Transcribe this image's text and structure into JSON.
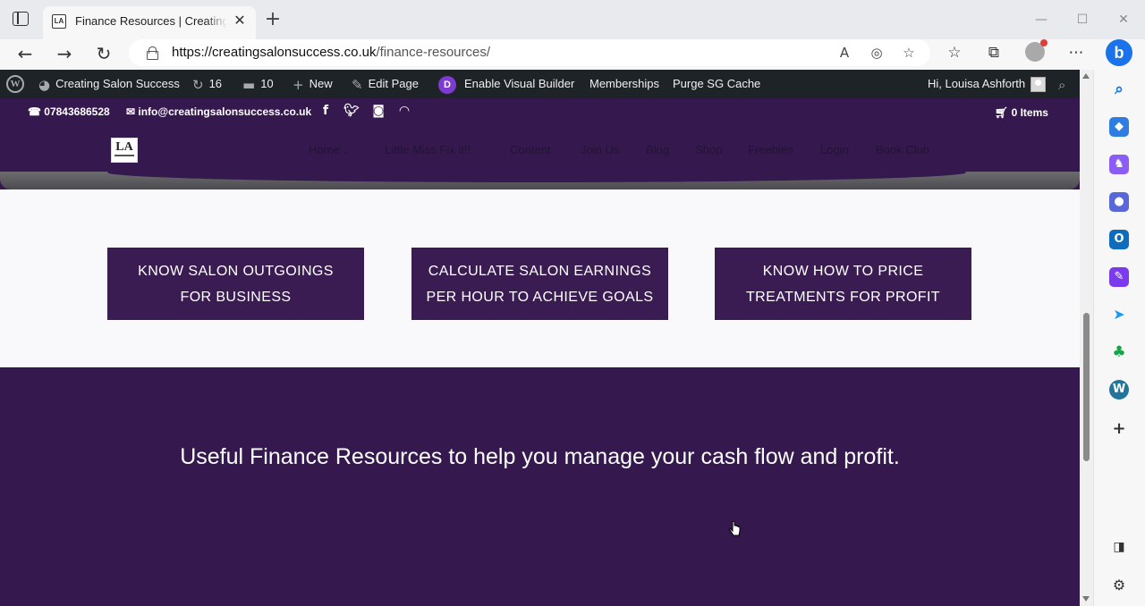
{
  "browser": {
    "tab_title": "Finance Resources | Creating Salon Success",
    "tab_favicon": "LA",
    "url_host": "https://creatingsalonsuccess.co.uk",
    "url_path": "/finance-resources/",
    "bing_label": "b"
  },
  "adminbar": {
    "wp_logo": "W",
    "site_name": "Creating Salon Success",
    "updates_count": "16",
    "comments_count": "10",
    "new_label": "New",
    "edit_label": "Edit Page",
    "divi_badge": "D",
    "visual_builder_label": "Enable Visual Builder",
    "memberships_label": "Memberships",
    "purge_label": "Purge SG Cache",
    "greeting": "Hi, Louisa Ashforth"
  },
  "header": {
    "phone": "07843686528",
    "email": "info@creatingsalonsuccess.co.uk",
    "cart_label": "0 Items",
    "logo_text": "LA",
    "menu": [
      {
        "label": "Home"
      },
      {
        "label": "Little Miss Fix it!!"
      },
      {
        "label": "Content"
      },
      {
        "label": "Join Us"
      },
      {
        "label": "Blog"
      },
      {
        "label": "Shop"
      },
      {
        "label": "Freebies"
      },
      {
        "label": "Login"
      },
      {
        "label": "Book Club"
      }
    ]
  },
  "buttons": [
    {
      "label": "KNOW SALON OUTGOINGS\nFOR BUSINESS"
    },
    {
      "label": "CALCULATE SALON EARNINGS\nPER HOUR TO ACHIEVE GOALS"
    },
    {
      "label": "KNOW HOW TO PRICE\nTREATMENTS FOR PROFIT"
    }
  ],
  "section": {
    "headline": "Useful Finance Resources to help you manage your cash flow and profit."
  },
  "colors": {
    "brand_purple": "#35194e",
    "button_purple": "#3a1c52",
    "adminbar": "#1d2327"
  }
}
